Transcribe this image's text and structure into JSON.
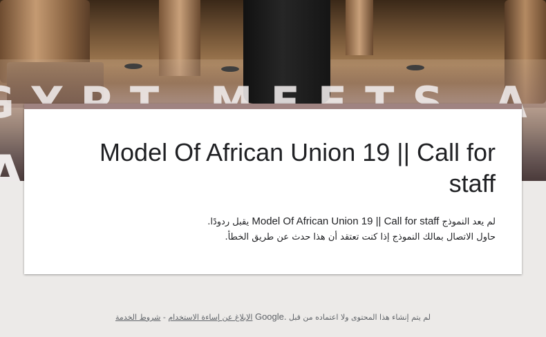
{
  "banner": {
    "bg_text_line1": "GYPT MEETS AFR",
    "bg_text_line2": "A                                   A"
  },
  "form": {
    "title": "Model Of African Union 19 || Call for staff",
    "closed_prefix": "لم يعد النموذج",
    "closed_form_name": "Model Of African Union 19 || Call for staff",
    "closed_suffix": "يقبل ردودًا.",
    "contact_line": "حاول الاتصال بمالك النموذج إذا كنت تعتقد أن هذا حدث عن طريق الخطأ."
  },
  "footer": {
    "disclaimer_pre": "لم يتم إنشاء هذا المحتوى ولا اعتماده من قبل",
    "google": "Google.",
    "report_link": "الإبلاغ عن إساءة الاستخدام",
    "separator": "-",
    "terms_link": "شروط الخدمة"
  },
  "colors": {
    "accent_bar": "#9f8381",
    "page_bg": "#eceae8"
  }
}
